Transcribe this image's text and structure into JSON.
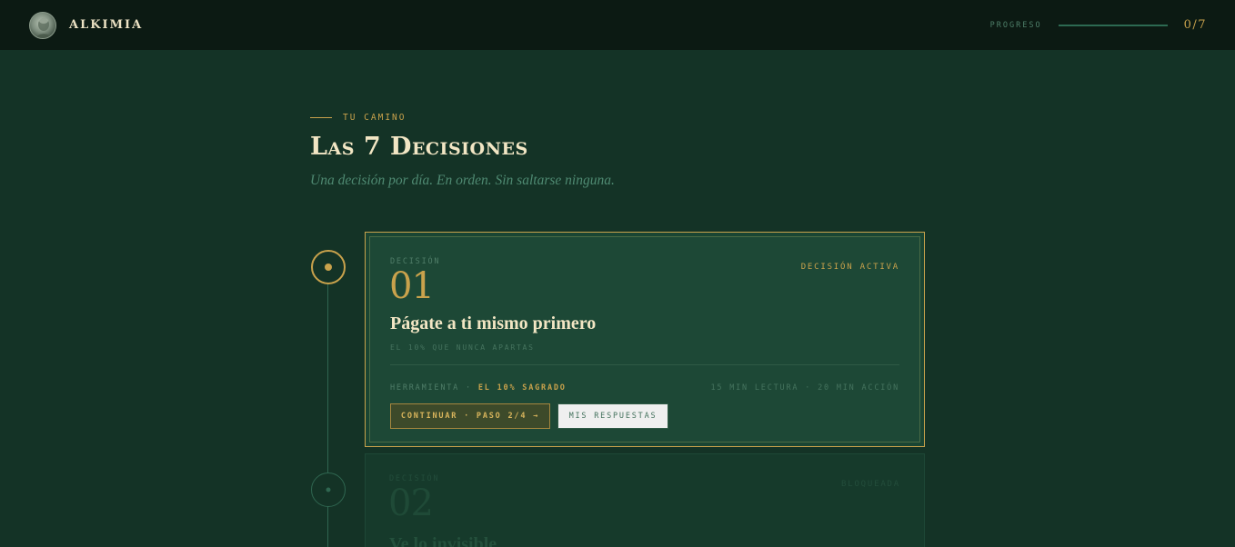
{
  "header": {
    "brand": "ALKIMIA",
    "progress_label": "PROGRESO",
    "progress_count": "0/7",
    "progress_fraction": 0
  },
  "hero": {
    "eyebrow": "TU CAMINO",
    "title": "Las 7 Decisiones",
    "subtitle": "Una decisión por día. En orden. Sin saltarse ninguna."
  },
  "decisions": [
    {
      "kicker": "DECISIÓN",
      "number": "01",
      "status": "DECISIÓN ACTIVA",
      "title": "Págate a ti mismo primero",
      "subtitle": "EL 10% QUE NUNCA APARTAS",
      "tool_label": "HERRAMIENTA ·",
      "tool_name": "EL 10% SAGRADO",
      "time": "15 MIN LECTURA · 20 MIN ACCIÓN",
      "primary_button": "CONTINUAR · PASO 2/4 →",
      "secondary_button": "MIS RESPUESTAS"
    },
    {
      "kicker": "DECISIÓN",
      "number": "02",
      "status": "BLOQUEADA",
      "title": "Ve lo invisible"
    }
  ],
  "colors": {
    "background": "#143326",
    "topbar": "#0c1a13",
    "gold": "#c9a24c",
    "cream": "#f2e6c4",
    "muted_green": "#4f8a72"
  }
}
